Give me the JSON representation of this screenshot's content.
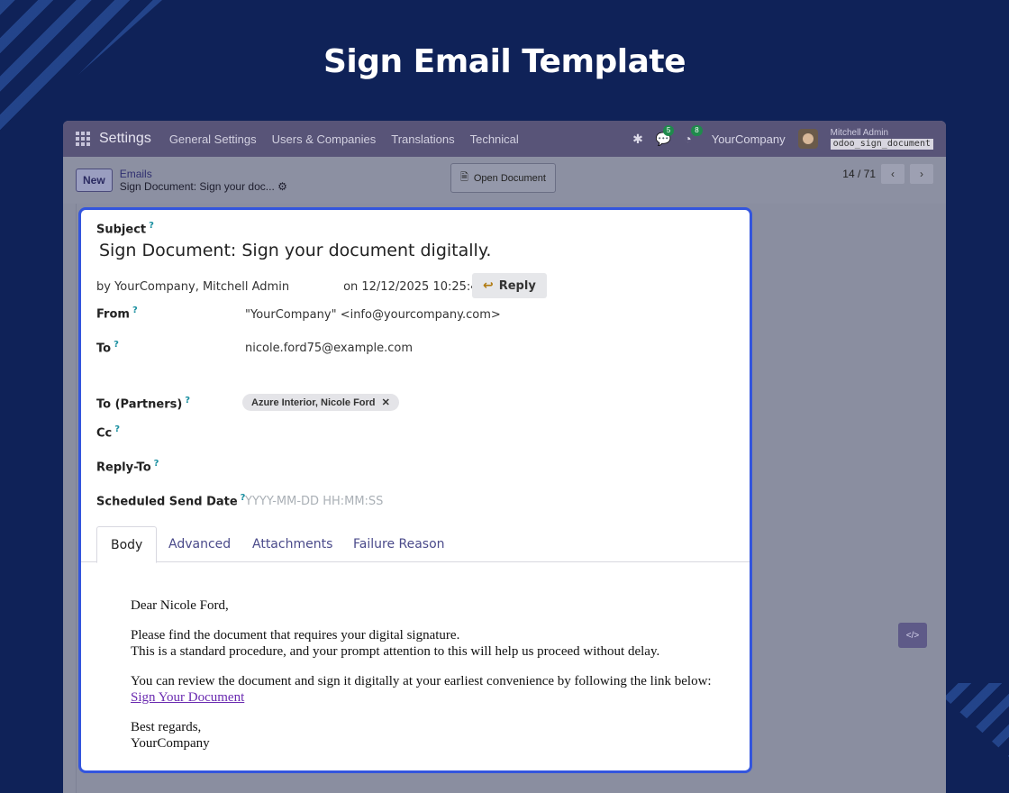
{
  "page": {
    "title": "Sign Email Template"
  },
  "navbar": {
    "brand": "Settings",
    "menus": [
      "General Settings",
      "Users & Companies",
      "Translations",
      "Technical"
    ],
    "messages_count": "5",
    "activities_count": "8",
    "company": "YourCompany",
    "user_name": "Mitchell Admin",
    "db_name": "odoo_sign_document"
  },
  "control": {
    "new_label": "New",
    "breadcrumb_parent": "Emails",
    "breadcrumb_current": "Sign Document: Sign your doc...",
    "open_document_label": "Open Document",
    "pager": "14 / 71"
  },
  "email": {
    "subject_label": "Subject",
    "subject": "Sign Document: Sign your document digitally.",
    "by_prefix": "by",
    "authors": "YourCompany, Mitchell Admin",
    "date": "on 12/12/2025 10:25:43",
    "reply_label": "Reply",
    "from_label": "From",
    "from": "\"YourCompany\" <info@yourcompany.com>",
    "to_label": "To",
    "to": "nicole.ford75@example.com",
    "to_partners_label": "To (Partners)",
    "partner_tag": "Azure Interior, Nicole Ford",
    "cc_label": "Cc",
    "reply_to_label": "Reply-To",
    "scheduled_label": "Scheduled Send Date",
    "scheduled_placeholder": "YYYY-MM-DD HH:MM:SS"
  },
  "tabs": [
    "Body",
    "Advanced",
    "Attachments",
    "Failure Reason"
  ],
  "body": {
    "greeting": "Dear Nicole Ford,",
    "line1": "Please find the document that requires your digital signature.",
    "line2": "This is a standard procedure, and your prompt attention to this will help us proceed without delay.",
    "line3": "You can review the document and sign it digitally at your earliest convenience by following the link below:",
    "link": "Sign Your Document",
    "closing": "Best regards,",
    "signature": "YourCompany"
  },
  "colors": {
    "accent": "#3355dd",
    "navbar": "#585478",
    "background": "#0f2258"
  }
}
